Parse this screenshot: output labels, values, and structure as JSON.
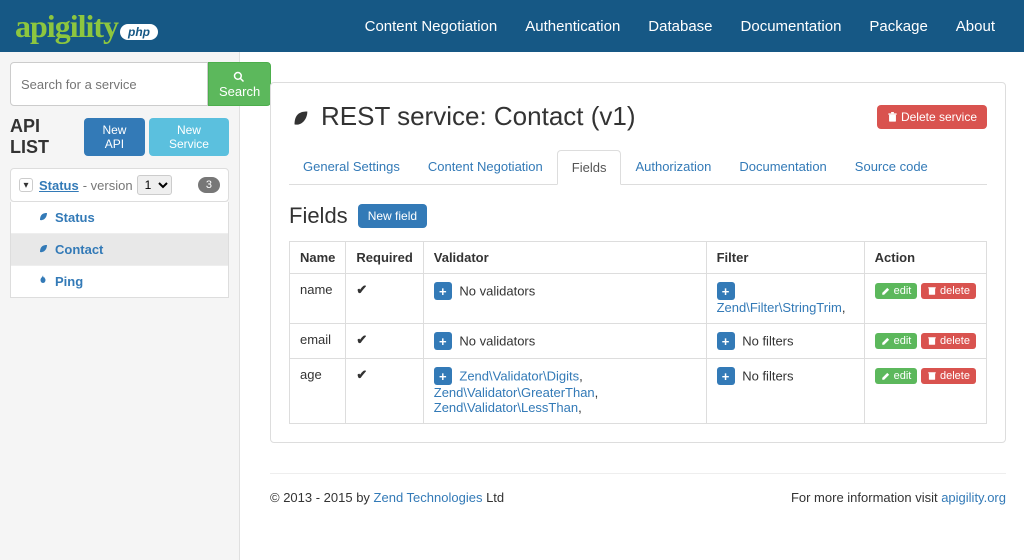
{
  "nav": {
    "brand": "apigility",
    "brand_badge": "php",
    "items": [
      "Content Negotiation",
      "Authentication",
      "Database",
      "Documentation",
      "Package",
      "About"
    ]
  },
  "sidebar": {
    "search_placeholder": "Search for a service",
    "search_button": "Search",
    "api_list_title": "API LIST",
    "new_api_label": "New API",
    "new_service_label": "New Service",
    "api": {
      "name": "Status",
      "version_label": "- version",
      "version": "1",
      "count": "3",
      "services": [
        {
          "name": "Status",
          "type": "rest",
          "active": false
        },
        {
          "name": "Contact",
          "type": "rest",
          "active": true
        },
        {
          "name": "Ping",
          "type": "rpc",
          "active": false
        }
      ]
    }
  },
  "main": {
    "title": "REST service: Contact (v1)",
    "delete_label": "Delete service",
    "tabs": [
      "General Settings",
      "Content Negotiation",
      "Fields",
      "Authorization",
      "Documentation",
      "Source code"
    ],
    "active_tab": 2,
    "fields": {
      "heading": "Fields",
      "new_field_label": "New field",
      "columns": [
        "Name",
        "Required",
        "Validator",
        "Filter",
        "Action"
      ],
      "rows": [
        {
          "name": "name",
          "required": true,
          "validators": [],
          "no_validators_text": "No validators",
          "filters": [
            "Zend\\Filter\\StringTrim"
          ],
          "no_filters_text": ""
        },
        {
          "name": "email",
          "required": true,
          "validators": [],
          "no_validators_text": "No validators",
          "filters": [],
          "no_filters_text": "No filters"
        },
        {
          "name": "age",
          "required": true,
          "validators": [
            "Zend\\Validator\\Digits",
            "Zend\\Validator\\GreaterThan",
            "Zend\\Validator\\LessThan"
          ],
          "no_validators_text": "",
          "filters": [],
          "no_filters_text": "No filters"
        }
      ],
      "edit_label": "edit",
      "delete_label": "delete"
    }
  },
  "footer": {
    "copyright_prefix": "© 2013 - 2015 by ",
    "company": "Zend Technologies",
    "copyright_suffix": " Ltd",
    "info_prefix": "For more information visit ",
    "info_link": "apigility.org"
  }
}
